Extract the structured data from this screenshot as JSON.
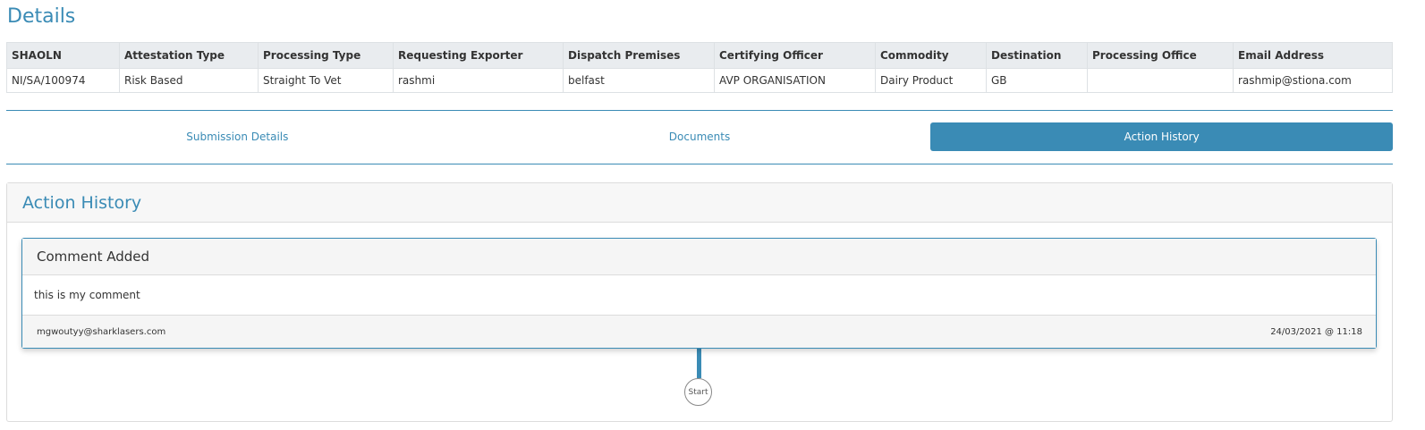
{
  "page": {
    "title": "Details"
  },
  "details_table": {
    "headers": [
      "SHAOLN",
      "Attestation Type",
      "Processing Type",
      "Requesting Exporter",
      "Dispatch Premises",
      "Certifying Officer",
      "Commodity",
      "Destination",
      "Processing Office",
      "Email Address"
    ],
    "row": [
      "NI/SA/100974",
      "Risk Based",
      "Straight To Vet",
      "rashmi",
      "belfast",
      "AVP ORGANISATION",
      "Dairy Product",
      "GB",
      "",
      "rashmip@stiona.com"
    ]
  },
  "tabs": [
    {
      "label": "Submission Details",
      "active": false
    },
    {
      "label": "Documents",
      "active": false
    },
    {
      "label": "Action History",
      "active": true
    }
  ],
  "action_history": {
    "title": "Action History",
    "entry": {
      "title": "Comment Added",
      "comment": "this is my comment",
      "author": "mgwoutyy@sharklasers.com",
      "timestamp": "24/03/2021 @ 11:18"
    },
    "start_label": "Start"
  },
  "colors": {
    "accent": "#3a8bb5",
    "header_bg": "#e9ecef",
    "panel_bg": "#f7f7f7"
  }
}
